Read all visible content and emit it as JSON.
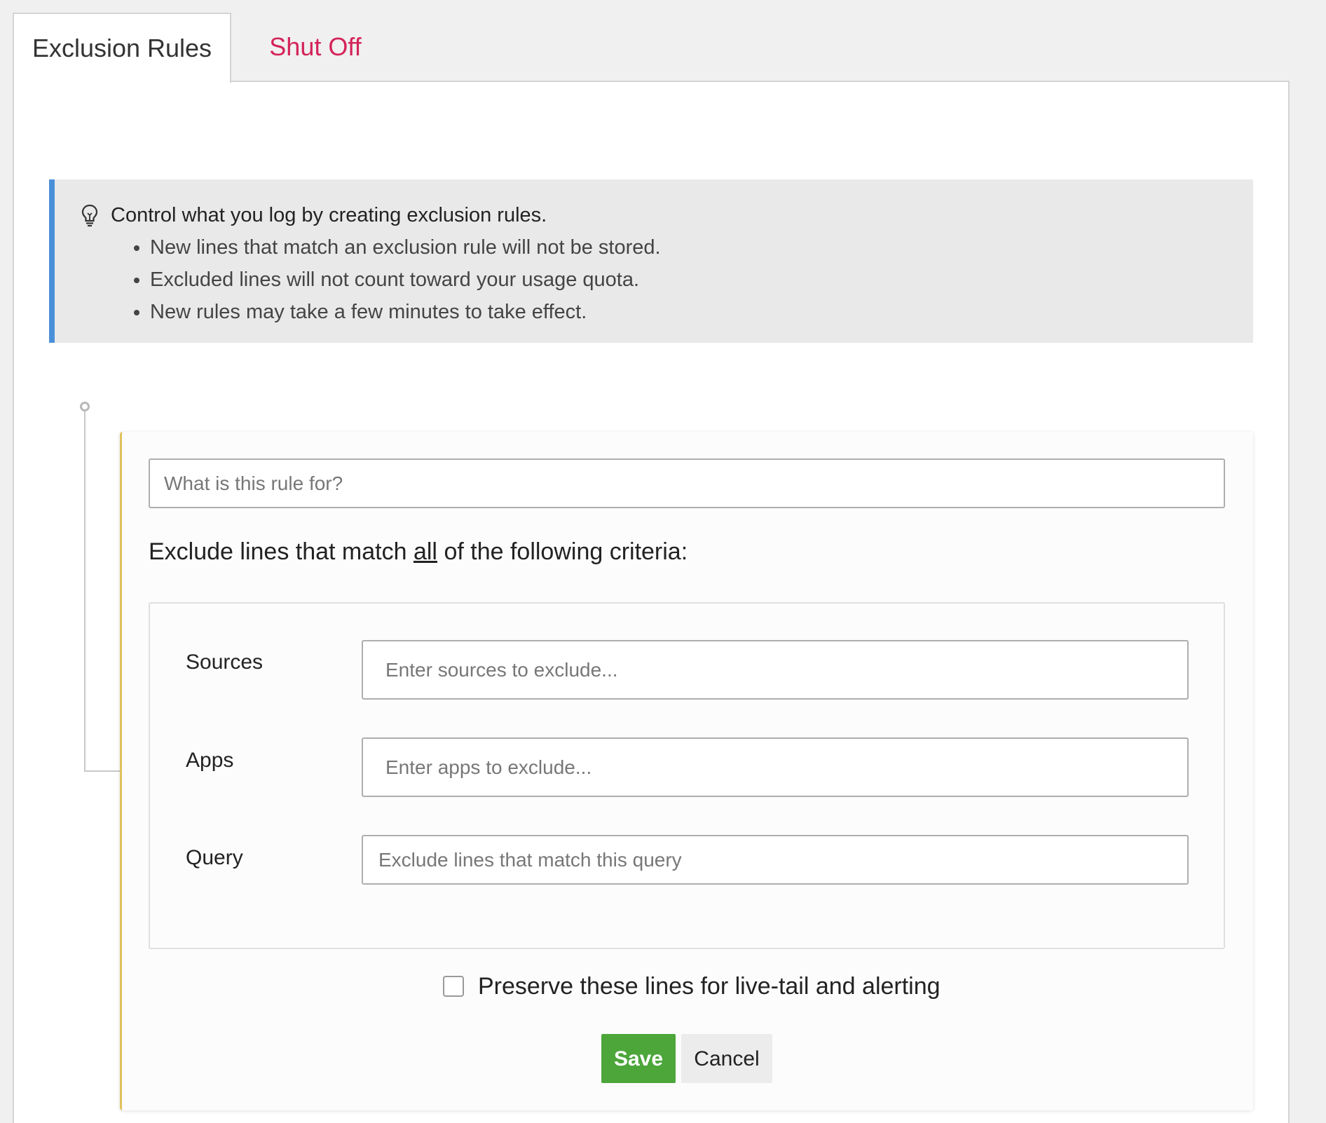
{
  "tabs": [
    {
      "label": "Exclusion Rules",
      "active": true
    },
    {
      "label": "Shut Off",
      "active": false,
      "color": "#d42359"
    }
  ],
  "info": {
    "icon": "lightbulb-icon",
    "heading": "Control what you log by creating exclusion rules.",
    "bullets": [
      "New lines that match an exclusion rule will not be stored.",
      "Excluded lines will not count toward your usage quota.",
      "New rules may take a few minutes to take effect."
    ],
    "accent_color": "#4a90d9"
  },
  "rule": {
    "name_placeholder": "What is this rule for?",
    "criteria_heading_prefix": "Exclude lines that match ",
    "criteria_heading_emphasis": "all",
    "criteria_heading_suffix": " of the following criteria:",
    "fields": {
      "sources": {
        "label": "Sources",
        "placeholder": "Enter sources to exclude..."
      },
      "apps": {
        "label": "Apps",
        "placeholder": "Enter apps to exclude..."
      },
      "query": {
        "label": "Query",
        "placeholder": "Exclude lines that match this query"
      }
    },
    "preserve_label": "Preserve these lines for live-tail and alerting",
    "preserve_checked": false,
    "card_accent_color": "#e2c15d"
  },
  "actions": {
    "save_label": "Save",
    "cancel_label": "Cancel",
    "save_color": "#4ca63a"
  }
}
